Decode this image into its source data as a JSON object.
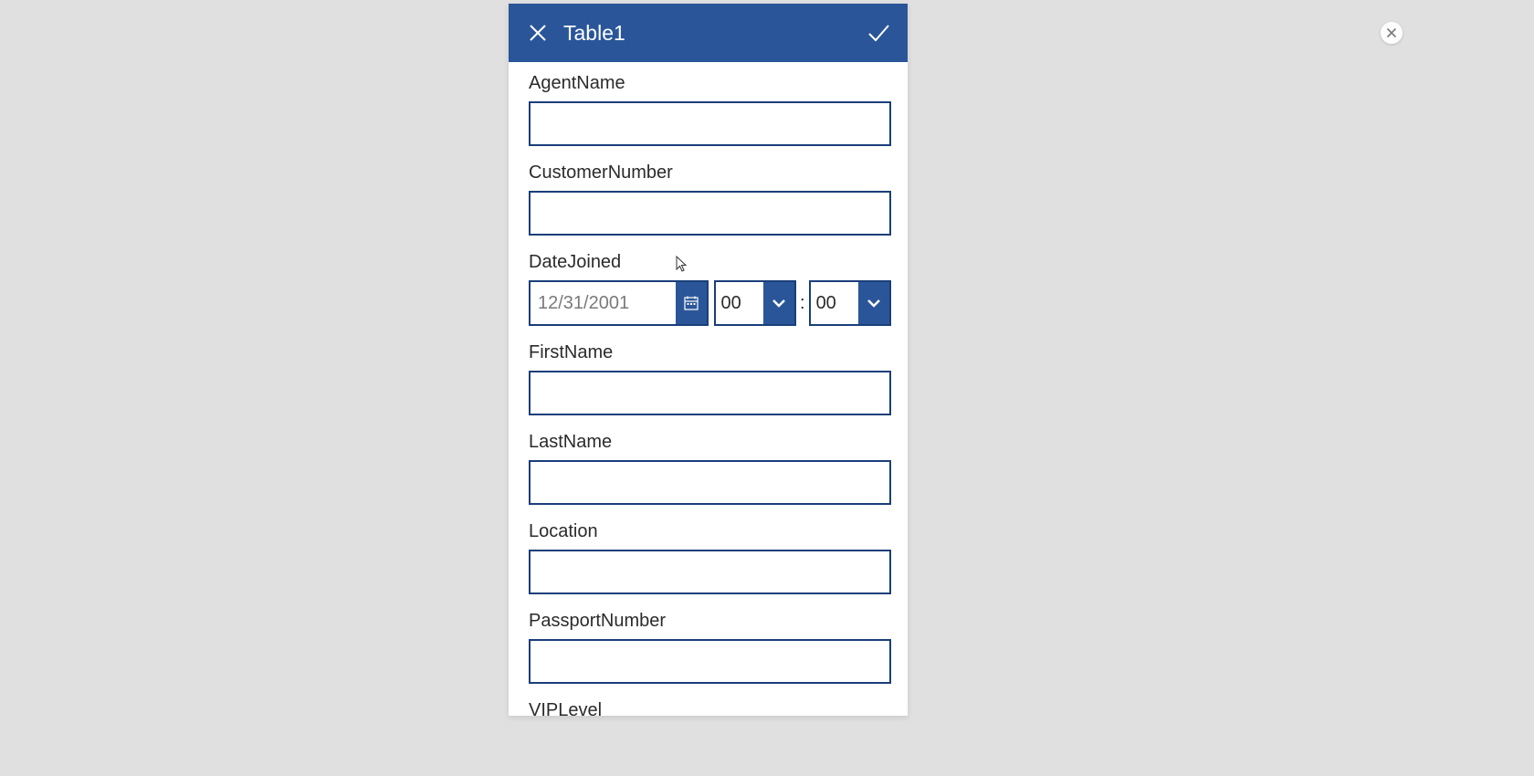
{
  "header": {
    "title": "Table1"
  },
  "fields": {
    "agentName": {
      "label": "AgentName",
      "value": ""
    },
    "customerNumber": {
      "label": "CustomerNumber",
      "value": ""
    },
    "dateJoined": {
      "label": "DateJoined",
      "date_placeholder": "12/31/2001",
      "hour": "00",
      "minute": "00",
      "separator": ":"
    },
    "firstName": {
      "label": "FirstName",
      "value": ""
    },
    "lastName": {
      "label": "LastName",
      "value": ""
    },
    "location": {
      "label": "Location",
      "value": ""
    },
    "passportNumber": {
      "label": "PassportNumber",
      "value": ""
    },
    "vipLevel": {
      "label": "VIPLevel",
      "value": ""
    }
  }
}
